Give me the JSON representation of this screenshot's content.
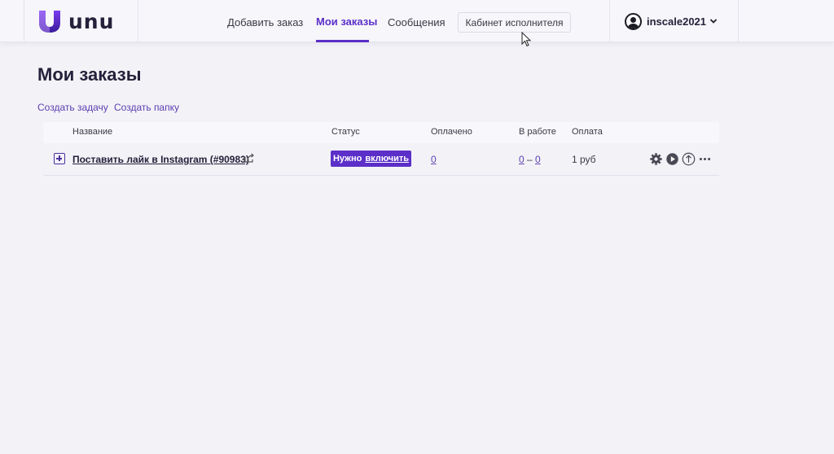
{
  "header": {
    "logo_text": "unu",
    "nav": [
      {
        "label": "Добавить заказ"
      },
      {
        "label": "Мои заказы"
      },
      {
        "label": "Сообщения"
      }
    ],
    "executor_button": "Кабинет исполнителя",
    "username": "inscale2021"
  },
  "page": {
    "title": "Мои заказы",
    "actions": [
      "Создать задачу",
      "Создать папку"
    ]
  },
  "table": {
    "headers": [
      "Название",
      "Статус",
      "Оплачено",
      "В работе",
      "Оплата"
    ],
    "rows": [
      {
        "name": "Поставить лайк в Instagram (#90983)",
        "status_prefix": "Нужно",
        "status_link": "включить",
        "paid": "0",
        "in_work_a": "0",
        "in_work_sep": "–",
        "in_work_b": "0",
        "payment": "1 руб"
      }
    ]
  },
  "colors": {
    "accent": "#5b2fc8",
    "background": "#f3f2f7"
  },
  "icons": [
    "logo-u-icon",
    "avatar-icon",
    "chevron-down-icon",
    "expand-plus-icon",
    "share-icon",
    "gear-icon",
    "play-icon",
    "arrow-up-icon",
    "more-icon"
  ]
}
